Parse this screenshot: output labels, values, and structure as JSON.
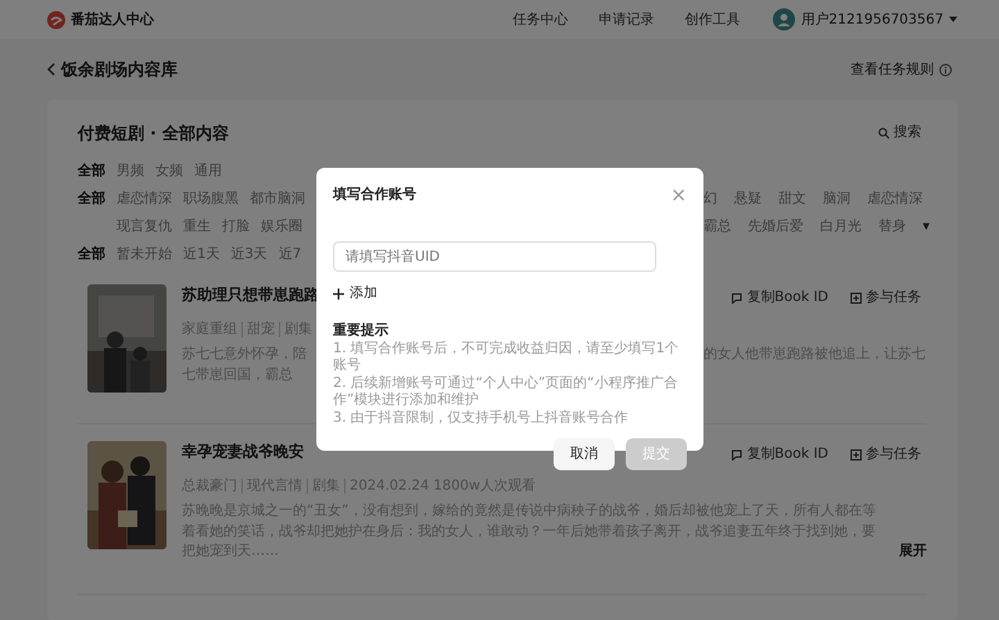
{
  "header": {
    "logo": "番茄达人中心",
    "nav": [
      {
        "label": "任务中心"
      },
      {
        "label": "申请记录"
      },
      {
        "label": "创作工具"
      }
    ],
    "user": "用户2121956703567"
  },
  "page": {
    "title": "饭余剧场内容库",
    "rules_link": "查看任务规则"
  },
  "panel": {
    "title": "付费短剧 · 全部内容",
    "search": "搜索",
    "filter_rows": [
      {
        "left": [
          {
            "label": "全部",
            "selected": true
          },
          {
            "label": "男频",
            "selected": false
          },
          {
            "label": "女频",
            "selected": false
          },
          {
            "label": "通用",
            "selected": false
          }
        ],
        "right": []
      },
      {
        "left": [
          {
            "label": "全部",
            "selected": true
          },
          {
            "label": "虐恋情深",
            "selected": false
          },
          {
            "label": "职场腹黑",
            "selected": false
          },
          {
            "label": "都市脑洞",
            "selected": false
          }
        ],
        "right": [
          {
            "label": "幻",
            "selected": false
          },
          {
            "label": "悬疑",
            "selected": false
          },
          {
            "label": "甜文",
            "selected": false
          },
          {
            "label": "脑洞",
            "selected": false
          },
          {
            "label": "虐恋情深",
            "selected": false
          }
        ]
      },
      {
        "left": [
          {
            "label": "现言复仇",
            "selected": false
          },
          {
            "label": "重生",
            "selected": false
          },
          {
            "label": "打脸",
            "selected": false
          },
          {
            "label": "娱乐圈",
            "selected": false
          }
        ],
        "right": [
          {
            "label": "霸总",
            "selected": false
          },
          {
            "label": "先婚后爱",
            "selected": false
          },
          {
            "label": "白月光",
            "selected": false
          },
          {
            "label": "替身",
            "selected": false
          }
        ],
        "more": "▾"
      },
      {
        "left": [
          {
            "label": "全部",
            "selected": true
          },
          {
            "label": "暂未开始",
            "selected": false
          },
          {
            "label": "近1天",
            "selected": false
          },
          {
            "label": "近3天",
            "selected": false
          },
          {
            "label": "近7",
            "selected": false
          }
        ],
        "right": []
      }
    ]
  },
  "items": [
    {
      "kind": "covered",
      "title": "苏助理只想带崽跑路",
      "meta": [
        "家庭重组",
        "甜宠",
        "剧集"
      ],
      "desc_left": [
        "苏七七意外怀孕，陪",
        "七带崽回国，霸总"
      ],
      "desc_right": [
        "的女人他带崽跑路被他追上，让苏七"
      ],
      "actions": [
        "复制Book ID",
        "参与任务"
      ]
    },
    {
      "kind": "full",
      "title": "幸孕宠妻战爷晚安",
      "meta": [
        "总裁豪门",
        "现代言情",
        "剧集",
        "2024.02.24 1800w人次观看"
      ],
      "desc": "苏晚晚是京城之一的“丑女”，没有想到，嫁给的竟然是传说中病秧子的战爷，婚后却被他宠上了天，所有人都在等着看她的笑话，战爷却把她护在身后：我的女人，谁敢动？一年后她带着孩子离开，战爷追妻五年终于找到她，要把她宠到天……",
      "expand": "展开",
      "actions": [
        "复制Book ID",
        "参与任务"
      ]
    }
  ],
  "modal": {
    "title": "填写合作账号",
    "close": "×",
    "placeholder": "请填写抖音UID",
    "add": "添加",
    "notes_title": "重要提示",
    "notes": [
      "1. 填写合作账号后，不可完成收益归因，请至少填写1个账号",
      "2. 后续新增账号可通过“个人中心”页面的“小程序推广合作”模块进行添加和维护",
      "3. 由于抖音限制，仅支持手机号上抖音账号合作"
    ],
    "cancel": "取消",
    "submit": "提交",
    "submit_disabled": true
  }
}
